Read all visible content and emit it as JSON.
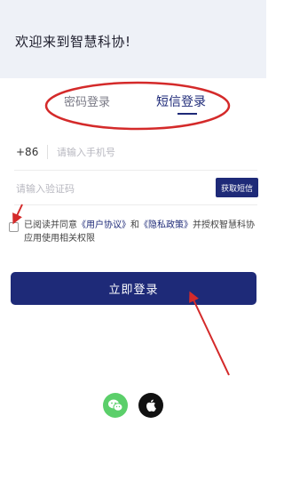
{
  "header": {
    "welcome": "欢迎来到智慧科协!"
  },
  "tabs": [
    {
      "label": "密码登录",
      "active": false
    },
    {
      "label": "短信登录",
      "active": true
    }
  ],
  "phone": {
    "country_code": "+86",
    "placeholder": "请输入手机号"
  },
  "code": {
    "placeholder": "请输入验证码",
    "get_code_label": "获取短信"
  },
  "agreement": {
    "prefix": "已阅读并同意",
    "user_agreement": "《用户协议》",
    "and": "和",
    "privacy_policy": "《隐私政策》",
    "suffix": "并授权智慧科协应用使用相关权限",
    "checked": false
  },
  "login_button": {
    "label": "立即登录"
  },
  "social": [
    {
      "icon": "wechat-icon",
      "color": "#5bcf6a"
    },
    {
      "icon": "apple-icon",
      "color": "#111111"
    }
  ],
  "colors": {
    "accent": "#1e2a78",
    "annotation": "#d42a2a"
  }
}
